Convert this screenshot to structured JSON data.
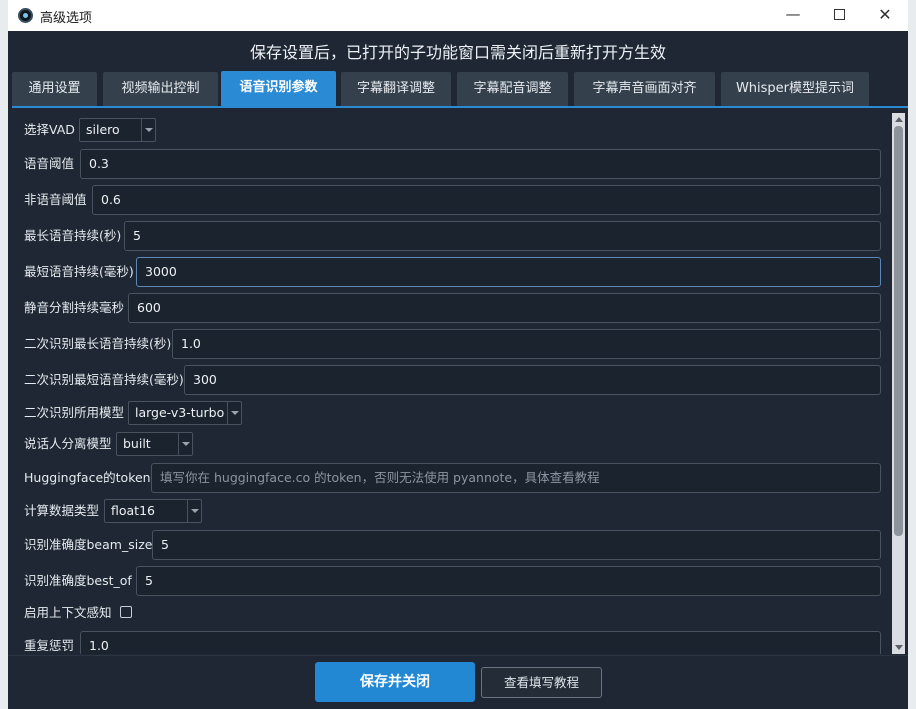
{
  "window": {
    "title": "高级选项",
    "minimize": "—",
    "close": "✕"
  },
  "notice": "保存设置后，已打开的子功能窗口需关闭后重新打开方生效",
  "tabs": [
    {
      "label": "通用设置",
      "active": false
    },
    {
      "label": "视频输出控制",
      "active": false
    },
    {
      "label": "语音识别参数",
      "active": true
    },
    {
      "label": "字幕翻译调整",
      "active": false
    },
    {
      "label": "字幕配音调整",
      "active": false
    },
    {
      "label": "字幕声音画面对齐",
      "active": false
    },
    {
      "label": "Whisper模型提示词",
      "active": false
    }
  ],
  "form": {
    "vad": {
      "label": "选择VAD",
      "value": "silero"
    },
    "speech_threshold": {
      "label": "语音阈值",
      "value": "0.3"
    },
    "nonspeech_threshold": {
      "label": "非语音阈值",
      "value": "0.6"
    },
    "max_speech_duration": {
      "label": "最长语音持续(秒)",
      "value": "5"
    },
    "min_speech_duration": {
      "label": "最短语音持续(毫秒)",
      "value": "3000"
    },
    "silence_split": {
      "label": "静音分割持续毫秒",
      "value": "600"
    },
    "second_max_speech": {
      "label": "二次识别最长语音持续(秒)",
      "value": "1.0"
    },
    "second_min_speech": {
      "label": "二次识别最短语音持续(毫秒)",
      "value": "300"
    },
    "second_model": {
      "label": "二次识别所用模型",
      "value": "large-v3-turbo"
    },
    "diarization_model": {
      "label": "说话人分离模型",
      "value": "built"
    },
    "hf_token": {
      "label": "Huggingface的token",
      "value": "",
      "placeholder": "填写你在 huggingface.co 的token，否则无法使用 pyannote，具体查看教程"
    },
    "compute_type": {
      "label": "计算数据类型",
      "value": "float16"
    },
    "beam_size": {
      "label": "识别准确度beam_size",
      "value": "5"
    },
    "best_of": {
      "label": "识别准确度best_of",
      "value": "5"
    },
    "context_aware": {
      "label": "启用上下文感知",
      "checked": false
    },
    "repetition_penalty": {
      "label": "重复惩罚",
      "value": "1.0"
    }
  },
  "footer": {
    "save_label": "保存并关闭",
    "tutorial_label": "查看填写教程"
  }
}
